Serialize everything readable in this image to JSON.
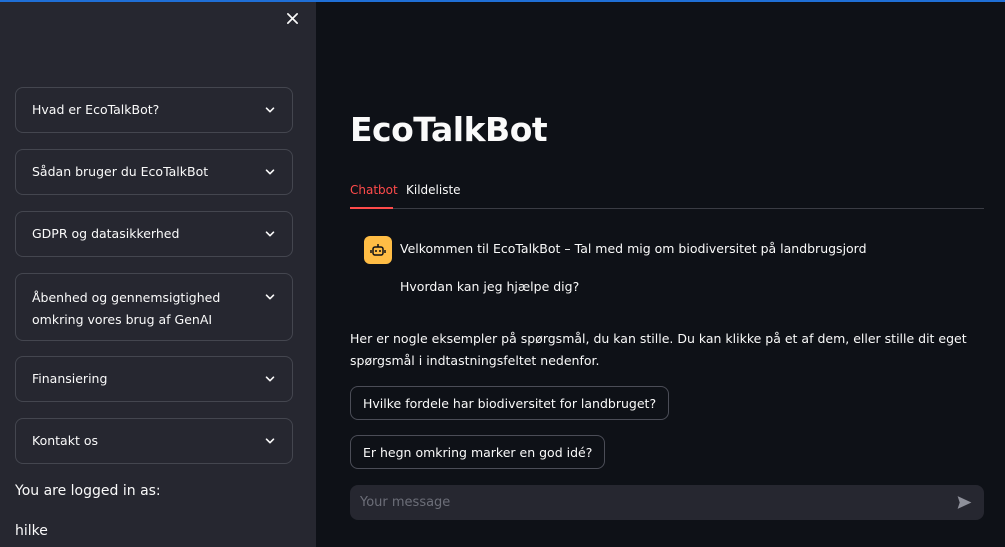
{
  "sidebar": {
    "close_icon": "close-icon",
    "expanders": [
      {
        "label": "Hvad er EcoTalkBot?"
      },
      {
        "label": "Sådan bruger du EcoTalkBot"
      },
      {
        "label": "GDPR og datasikkerhed"
      },
      {
        "label": "Åbenhed og gennemsigtighed omkring vores brug af GenAI"
      },
      {
        "label": "Finansiering"
      },
      {
        "label": "Kontakt os"
      }
    ],
    "logged_in_label": "You are logged in as:",
    "username": "hilke"
  },
  "main": {
    "title": "EcoTalkBot",
    "tabs": [
      {
        "label": "Chatbot",
        "active": true
      },
      {
        "label": "Kildeliste",
        "active": false
      }
    ],
    "bot_message": {
      "line1": "Velkommen til EcoTalkBot – Tal med mig om biodiversitet på landbrugsjord",
      "line2": "Hvordan kan jeg hjælpe dig?"
    },
    "examples_text": "Her er nogle eksempler på spørgsmål, du kan stille. Du kan klikke på et af dem, eller stille dit eget spørgsmål i indtastningsfeltet nedenfor.",
    "example_buttons": [
      {
        "label": "Hvilke fordele har biodiversitet for landbruget?"
      },
      {
        "label": "Er hegn omkring marker en god idé?"
      }
    ],
    "chat_input": {
      "placeholder": "Your message",
      "value": ""
    }
  },
  "colors": {
    "background": "#0e1117",
    "sidebar": "#262730",
    "accent": "#ff4b4b",
    "bot_avatar": "#ffbd45"
  }
}
